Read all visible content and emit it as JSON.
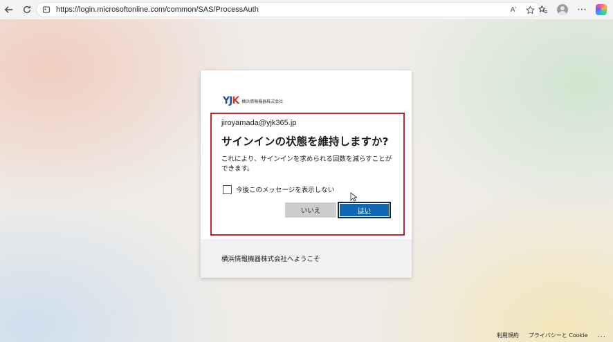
{
  "browser": {
    "url": "https://login.microsoftonline.com/common/SAS/ProcessAuth",
    "read_aloud_label": "Aʹ",
    "more_label": "⋯"
  },
  "card": {
    "logo_mark": "YJK",
    "logo_text": "横浜情報機器株式会社",
    "email": "jiroyamada@yjk365.jp",
    "title": "サインインの状態を維持しますか?",
    "description": "これにより、サインインを求められる回数を減らすことができます。",
    "checkbox_label": "今後このメッセージを表示しない",
    "checkbox_checked": false,
    "no_button": "いいえ",
    "yes_button": "はい",
    "footer_text": "横浜情報機器株式会社へようこそ"
  },
  "page_footer": {
    "terms": "利用規約",
    "privacy": "プライバシーと Cookie",
    "more": "..."
  },
  "colors": {
    "primary_button": "#0f67b8",
    "highlight_border": "#c8232c",
    "logo_blue": "#1e4fa0",
    "logo_red": "#d23a2a"
  }
}
